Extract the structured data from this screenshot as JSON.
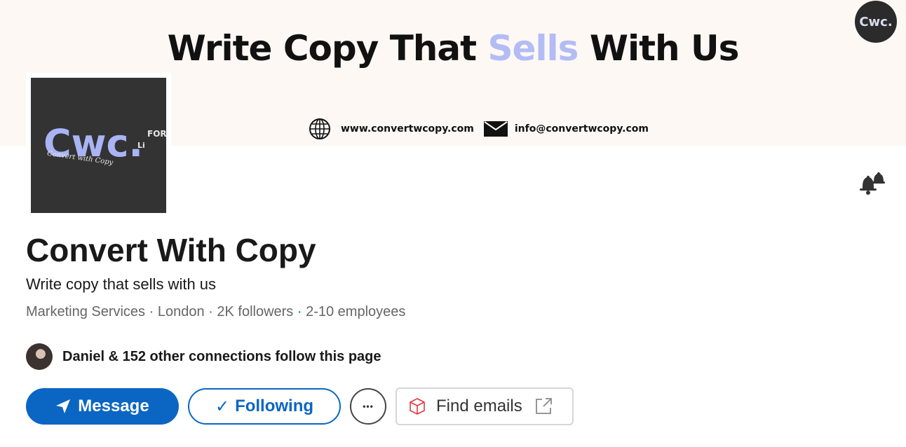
{
  "banner": {
    "headline_before": "Write Copy That",
    "headline_accent": "Sells",
    "headline_after": "With Us",
    "website": "www.convertwcopy.com",
    "email": "info@convertwcopy.com",
    "corner_logo": "Cwc.",
    "accent_color": "#b3bcf5"
  },
  "logo": {
    "mark": "Cwc.",
    "for": "FOR",
    "li": "Li",
    "script": "Convert with Copy",
    "background_color": "#333334",
    "mark_color": "#a9b4f4"
  },
  "company": {
    "name": "Convert With Copy",
    "tagline": "Write copy that sells with us",
    "industry": "Marketing Services",
    "location": "London",
    "followers": "2K followers",
    "employees": "2-10 employees",
    "sep": " · "
  },
  "connections": {
    "text": "Daniel & 152 other connections follow this page"
  },
  "actions": {
    "message_label": "Message",
    "following_label": "Following",
    "check_glyph": "✓",
    "more_glyph": "•••",
    "find_emails_label": "Find emails",
    "primary_color": "#0a66c2"
  },
  "icons": {
    "bell": "notification-bell-icon",
    "send": "paper-plane-icon",
    "globe": "globe-icon",
    "mail": "envelope-icon",
    "cube": "cube-icon",
    "external": "external-link-icon"
  }
}
